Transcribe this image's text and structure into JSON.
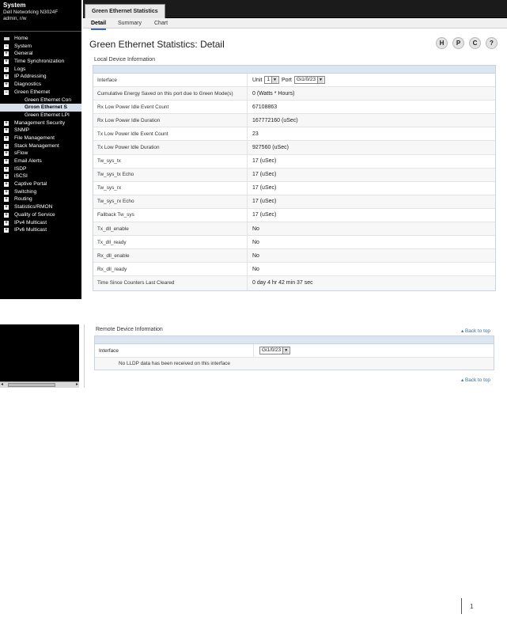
{
  "sidebar": {
    "title": "System",
    "model": "Dell Networking N3024F",
    "user": "admin, r/w",
    "items": [
      {
        "label": "Home",
        "level": 0,
        "type": "home"
      },
      {
        "label": "System",
        "level": 0,
        "type": "minus"
      },
      {
        "label": "General",
        "level": 1,
        "type": "plus"
      },
      {
        "label": "Time Synchronization",
        "level": 1,
        "type": "plus"
      },
      {
        "label": "Logs",
        "level": 1,
        "type": "plus"
      },
      {
        "label": "IP Addressing",
        "level": 1,
        "type": "plus"
      },
      {
        "label": "Diagnostics",
        "level": 1,
        "type": "plus"
      },
      {
        "label": "Green Ethernet",
        "level": 1,
        "type": "minus"
      },
      {
        "label": "Green Ethernet Con",
        "level": 2,
        "type": "leaf"
      },
      {
        "label": "Green Ethernet S",
        "level": 2,
        "type": "leaf",
        "selected": true
      },
      {
        "label": "Green Ethernet LPI",
        "level": 2,
        "type": "leaf"
      },
      {
        "label": "Management Security",
        "level": 1,
        "type": "plus"
      },
      {
        "label": "SNMP",
        "level": 1,
        "type": "plus"
      },
      {
        "label": "File Management",
        "level": 1,
        "type": "plus"
      },
      {
        "label": "Stack Management",
        "level": 1,
        "type": "plus"
      },
      {
        "label": "sFlow",
        "level": 1,
        "type": "plus"
      },
      {
        "label": "Email Alerts",
        "level": 1,
        "type": "plus"
      },
      {
        "label": "ISDP",
        "level": 1,
        "type": "plus"
      },
      {
        "label": "iSCSI",
        "level": 1,
        "type": "plus"
      },
      {
        "label": "Captive Portal",
        "level": 1,
        "type": "plus"
      },
      {
        "label": "Switching",
        "level": 0,
        "type": "plus"
      },
      {
        "label": "Routing",
        "level": 0,
        "type": "plus"
      },
      {
        "label": "Statistics/RMON",
        "level": 0,
        "type": "plus"
      },
      {
        "label": "Quality of Service",
        "level": 0,
        "type": "plus"
      },
      {
        "label": "IPv4 Multicast",
        "level": 0,
        "type": "plus"
      },
      {
        "label": "IPv6 Multicast",
        "level": 0,
        "type": "plus"
      }
    ]
  },
  "header": {
    "tab": "Green Ethernet Statistics",
    "subtabs": [
      "Detail",
      "Summary",
      "Chart"
    ],
    "page_title": "Green Ethernet Statistics: Detail",
    "tools": [
      "H",
      "P",
      "C",
      "?"
    ]
  },
  "local": {
    "section_title": "Local Device Information",
    "interface_label": "Interface",
    "unit_label": "Unit",
    "unit_value": "1",
    "port_label": "Port",
    "port_value": "Gi1/0/23",
    "rows": [
      {
        "label": "Cumulative Energy Saved on this port due to Green Mode(s)",
        "value": "0   (Watts * Hours)"
      },
      {
        "label": "Rx Low Power Idle Event Count",
        "value": "67108863"
      },
      {
        "label": "Rx Low Power Idle Duration",
        "value": "167772160   (uSec)"
      },
      {
        "label": "Tx Low Power Idle Event Count",
        "value": "23"
      },
      {
        "label": "Tx Low Power Idle Duration",
        "value": "927560   (uSec)"
      },
      {
        "label": "Tw_sys_tx",
        "value": "17   (uSec)"
      },
      {
        "label": "Tw_sys_tx Echo",
        "value": "17   (uSec)"
      },
      {
        "label": "Tw_sys_rx",
        "value": "17   (uSec)"
      },
      {
        "label": "Tw_sys_rx Echo",
        "value": "17   (uSec)"
      },
      {
        "label": "Fallback Tw_sys",
        "value": "17   (uSec)"
      },
      {
        "label": "Tx_dll_enable",
        "value": "No"
      },
      {
        "label": "Tx_dll_ready",
        "value": "No"
      },
      {
        "label": "Rx_dll_enable",
        "value": "No"
      },
      {
        "label": "Rx_dll_ready",
        "value": "No"
      },
      {
        "label": "Time Since Counters Last Cleared",
        "value": "0 day 4 hr 42 min 37 sec"
      }
    ]
  },
  "remote": {
    "section_title": "Remote Device Information",
    "back_to_top": "Back to top",
    "interface_label": "Interface",
    "interface_value": "Gi1/0/23",
    "message": "No LLDP data has been received on this interface"
  },
  "page_number": "1"
}
